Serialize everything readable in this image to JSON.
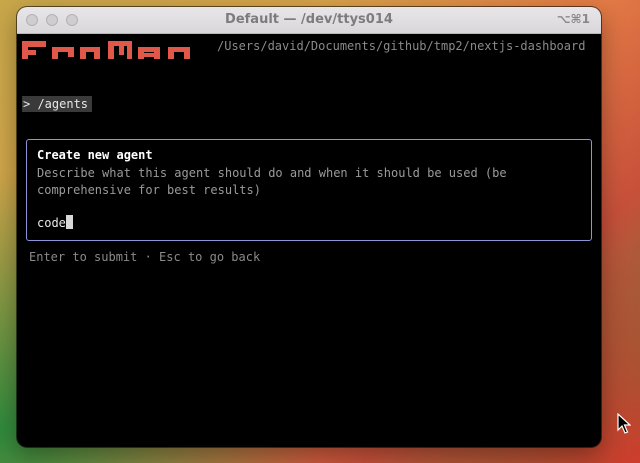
{
  "window": {
    "title": "Default — /dev/ttys014",
    "shortcut": "⌥⌘1"
  },
  "terminal": {
    "cwd": "/Users/david/Documents/github/tmp2/nextjs-dashboard",
    "command": "> /agents",
    "logo_icon": "pixel-wordmark-logo",
    "logo_color": "#e0584a"
  },
  "panel": {
    "title": "Create new agent",
    "description": "Describe what this agent should do and when it should be used (be comprehensive for best results)",
    "input_value": "code",
    "border_color": "#8c93d8"
  },
  "hint": "Enter to submit · Esc to go back"
}
